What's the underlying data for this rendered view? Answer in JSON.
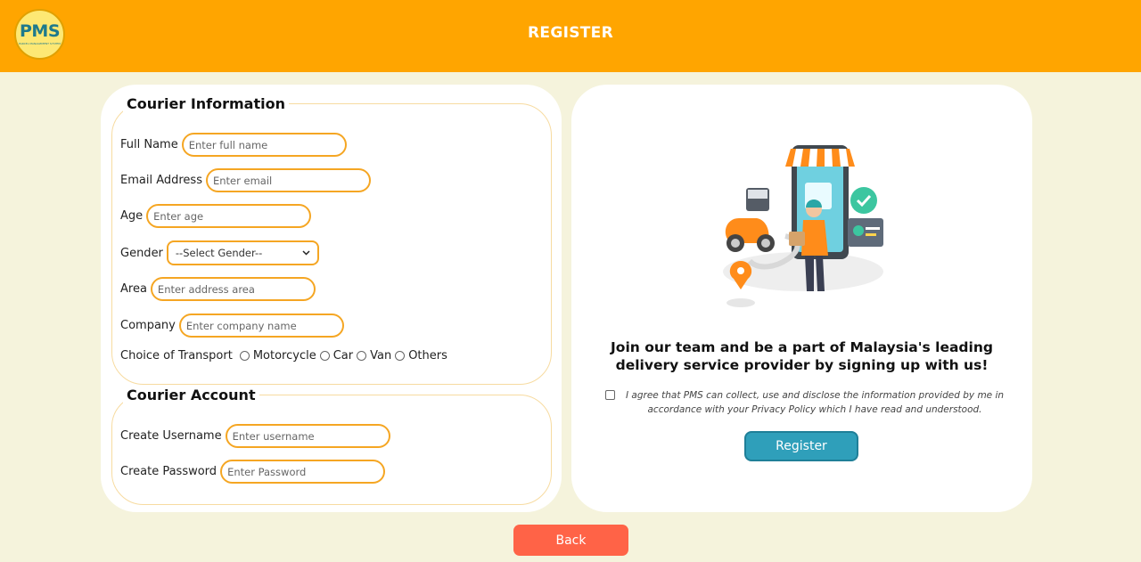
{
  "header": {
    "logo_text": "PMS",
    "logo_sub": "PARCEL MANAGEMENT SYSTEM",
    "title": "REGISTER"
  },
  "courier_info": {
    "legend": "Courier Information",
    "full_name": {
      "label": "Full Name",
      "placeholder": "Enter full name"
    },
    "email": {
      "label": "Email Address",
      "placeholder": "Enter email"
    },
    "age": {
      "label": "Age",
      "placeholder": "Enter age"
    },
    "gender": {
      "label": "Gender",
      "selected": "--Select Gender--"
    },
    "area": {
      "label": "Area",
      "placeholder": "Enter address area"
    },
    "company": {
      "label": "Company",
      "placeholder": "Enter company name"
    },
    "transport": {
      "label": "Choice of Transport",
      "options": [
        "Motorcycle",
        "Car",
        "Van",
        "Others"
      ]
    }
  },
  "courier_account": {
    "legend": "Courier Account",
    "username": {
      "label": "Create Username",
      "placeholder": "Enter username"
    },
    "password": {
      "label": "Create Password",
      "placeholder": "Enter Password"
    }
  },
  "promo": {
    "line1": "Join our team and be a part of Malaysia's leading",
    "line2": "delivery service provider by signing up with us!",
    "agree_line1": "I agree that PMS can collect, use and disclose the information provided by me in",
    "agree_line2": "accordance with your Privacy Policy which I have read and understood.",
    "register_label": "Register"
  },
  "back_label": "Back",
  "colors": {
    "header": "#ffa500",
    "background": "#f5f3dc",
    "field_border": "#f5a623",
    "register_button": "#2f9fba",
    "back_button": "#ff6347"
  }
}
